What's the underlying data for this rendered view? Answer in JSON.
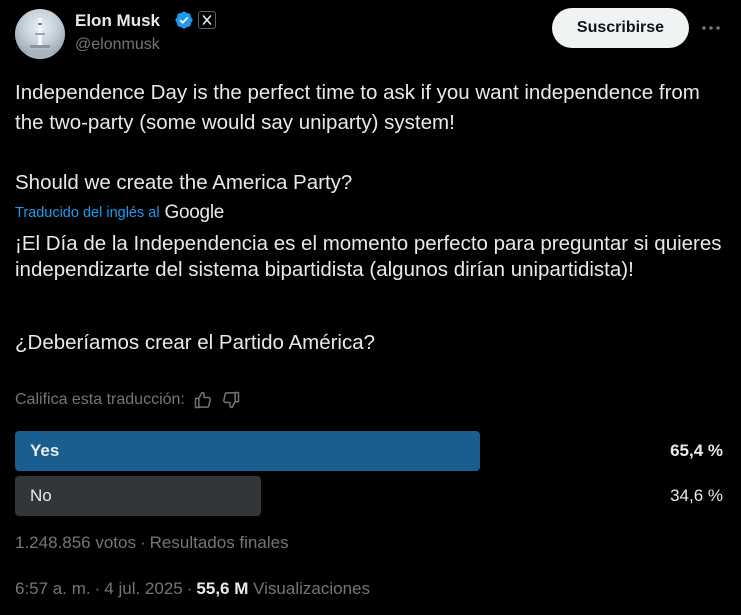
{
  "author": {
    "name": "Elon Musk",
    "handle": "@elonmusk",
    "verified_icon": "verified-badge-icon",
    "affiliate_icon": "x-logo-icon"
  },
  "header": {
    "subscribe_label": "Suscribirse",
    "more_icon": "more-options-icon"
  },
  "tweet": {
    "original_p1": "Independence Day is the perfect time to ask if you want independence from the two-party (some would say uniparty) system!",
    "original_p2": "Should we create the America Party?",
    "translated_label": "Traducido del inglés al",
    "translator_brand": "Google",
    "translated_p1": "¡El Día de la Independencia es el momento perfecto para preguntar si quieres independizarte del sistema bipartidista (algunos dirían unipartidista)!",
    "translated_p2": "¿Deberíamos crear el Partido América?",
    "rate_label": "Califica esta traducción:",
    "rate_icons": [
      "thumbs-up-icon",
      "thumbs-down-icon"
    ]
  },
  "poll": {
    "options": [
      {
        "label": "Yes",
        "percent_text": "65,4 %",
        "share": 0.654,
        "winner": true
      },
      {
        "label": "No",
        "percent_text": "34,6 %",
        "share": 0.346,
        "winner": false
      }
    ],
    "votes": "1.248.856 votos",
    "dot": "·",
    "status": "Resultados finales"
  },
  "meta": {
    "time": "6:57 a. m.",
    "dot": "·",
    "date": "4 jul. 2025",
    "dot2": "·",
    "views_count": "55,6 M",
    "views_label": "Visualizaciones"
  },
  "colors": {
    "background": "#000000",
    "text": "#e7e9ea",
    "muted": "#71767b",
    "link": "#1d9bf0",
    "verified": "#1d9bf0",
    "poll_winner": "#1a5e8f",
    "poll_other": "#333639",
    "button_bg": "#eff3f4"
  }
}
